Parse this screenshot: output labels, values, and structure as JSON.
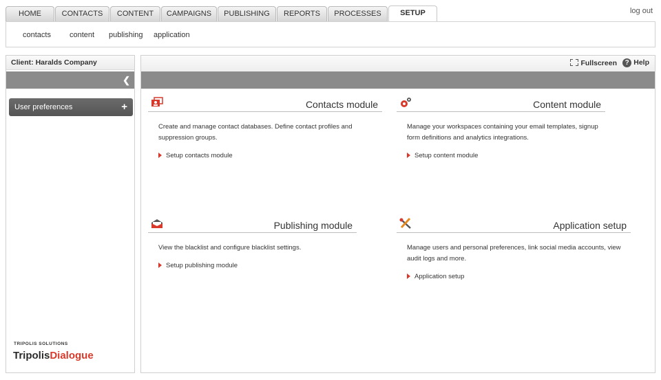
{
  "tabs": [
    {
      "label": "HOME"
    },
    {
      "label": "CONTACTS"
    },
    {
      "label": "CONTENT"
    },
    {
      "label": "CAMPAIGNS"
    },
    {
      "label": "PUBLISHING"
    },
    {
      "label": "REPORTS"
    },
    {
      "label": "PROCESSES"
    },
    {
      "label": "SETUP",
      "active": true
    }
  ],
  "logout_label": "log out",
  "subnav": [
    {
      "label": "contacts"
    },
    {
      "label": "content"
    },
    {
      "label": "publishing"
    },
    {
      "label": "application"
    }
  ],
  "sidebar": {
    "client_label": "Client: Haralds Company",
    "collapse_icon": "chevron-left-icon",
    "items": [
      {
        "label": "User preferences",
        "icon": "plus-icon"
      }
    ],
    "brand_small": "TRIPOLIS SOLUTIONS",
    "brand_part1": "Tripolis",
    "brand_part2": "Dialogue",
    "brand_color": "#d73a2b"
  },
  "main": {
    "fullscreen_label": "Fullscreen",
    "help_label": "Help",
    "modules": [
      {
        "title": "Contacts module",
        "icon": "contacts-icon",
        "desc": "Create and manage contact databases. Define contact profiles and suppression groups.",
        "link": "Setup contacts module"
      },
      {
        "title": "Content module",
        "icon": "gears-icon",
        "desc": "Manage your workspaces containing your email templates, signup form definitions and analytics integrations.",
        "link": "Setup content module"
      },
      {
        "title": "Publishing module",
        "icon": "mail-icon",
        "desc": "View the blacklist and configure blacklist settings.",
        "link": "Setup publishing module"
      },
      {
        "title": "Application setup",
        "icon": "tools-icon",
        "desc": "Manage users and personal preferences, link social media accounts, view audit logs and more.",
        "link": "Application setup"
      }
    ]
  },
  "colors": {
    "accent": "#d73a2b",
    "grey_bar": "#8b8b8b"
  }
}
